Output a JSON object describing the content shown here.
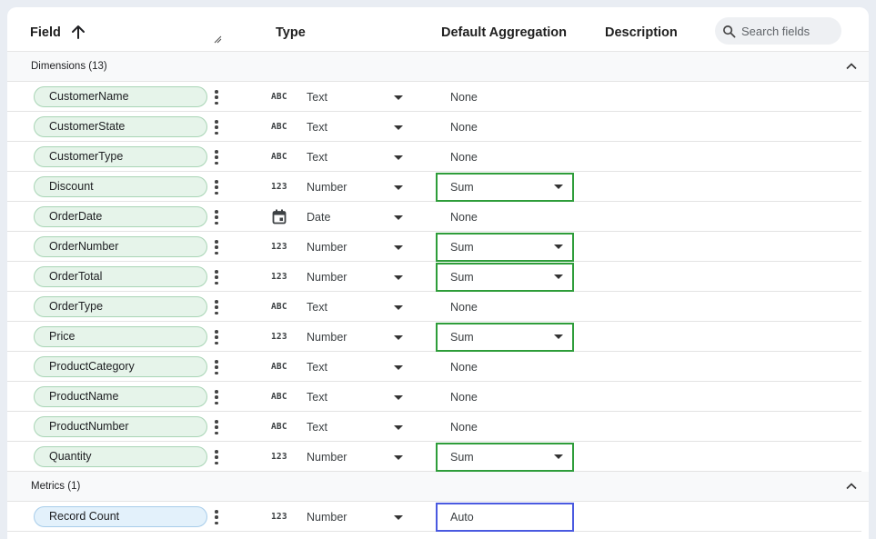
{
  "header": {
    "field": "Field",
    "type": "Type",
    "default_aggregation": "Default Aggregation",
    "description": "Description",
    "search_placeholder": "Search fields"
  },
  "sections": [
    {
      "label": "Dimensions (13)"
    },
    {
      "label": "Metrics (1)"
    }
  ],
  "dimensions": [
    {
      "name": "CustomerName",
      "type_icon": "ABC",
      "type": "Text",
      "aggregation": "None",
      "agg_editable": false
    },
    {
      "name": "CustomerState",
      "type_icon": "ABC",
      "type": "Text",
      "aggregation": "None",
      "agg_editable": false
    },
    {
      "name": "CustomerType",
      "type_icon": "ABC",
      "type": "Text",
      "aggregation": "None",
      "agg_editable": false
    },
    {
      "name": "Discount",
      "type_icon": "123",
      "type": "Number",
      "aggregation": "Sum",
      "agg_editable": true
    },
    {
      "name": "OrderDate",
      "type_icon": "calendar-icon",
      "type": "Date",
      "aggregation": "None",
      "agg_editable": false
    },
    {
      "name": "OrderNumber",
      "type_icon": "123",
      "type": "Number",
      "aggregation": "Sum",
      "agg_editable": true
    },
    {
      "name": "OrderTotal",
      "type_icon": "123",
      "type": "Number",
      "aggregation": "Sum",
      "agg_editable": true
    },
    {
      "name": "OrderType",
      "type_icon": "ABC",
      "type": "Text",
      "aggregation": "None",
      "agg_editable": false
    },
    {
      "name": "Price",
      "type_icon": "123",
      "type": "Number",
      "aggregation": "Sum",
      "agg_editable": true
    },
    {
      "name": "ProductCategory",
      "type_icon": "ABC",
      "type": "Text",
      "aggregation": "None",
      "agg_editable": false
    },
    {
      "name": "ProductName",
      "type_icon": "ABC",
      "type": "Text",
      "aggregation": "None",
      "agg_editable": false
    },
    {
      "name": "ProductNumber",
      "type_icon": "ABC",
      "type": "Text",
      "aggregation": "None",
      "agg_editable": false
    },
    {
      "name": "Quantity",
      "type_icon": "123",
      "type": "Number",
      "aggregation": "Sum",
      "agg_editable": true
    }
  ],
  "metrics": [
    {
      "name": "Record Count",
      "type_icon": "123",
      "type": "Number",
      "aggregation": "Auto",
      "agg_editable": true
    }
  ],
  "colors": {
    "dimension_chip_bg": "#e6f4ea",
    "metric_chip_bg": "#e3f1fb",
    "agg_highlight_green": "#2e9d3a",
    "agg_highlight_blue": "#4a5ae0"
  }
}
